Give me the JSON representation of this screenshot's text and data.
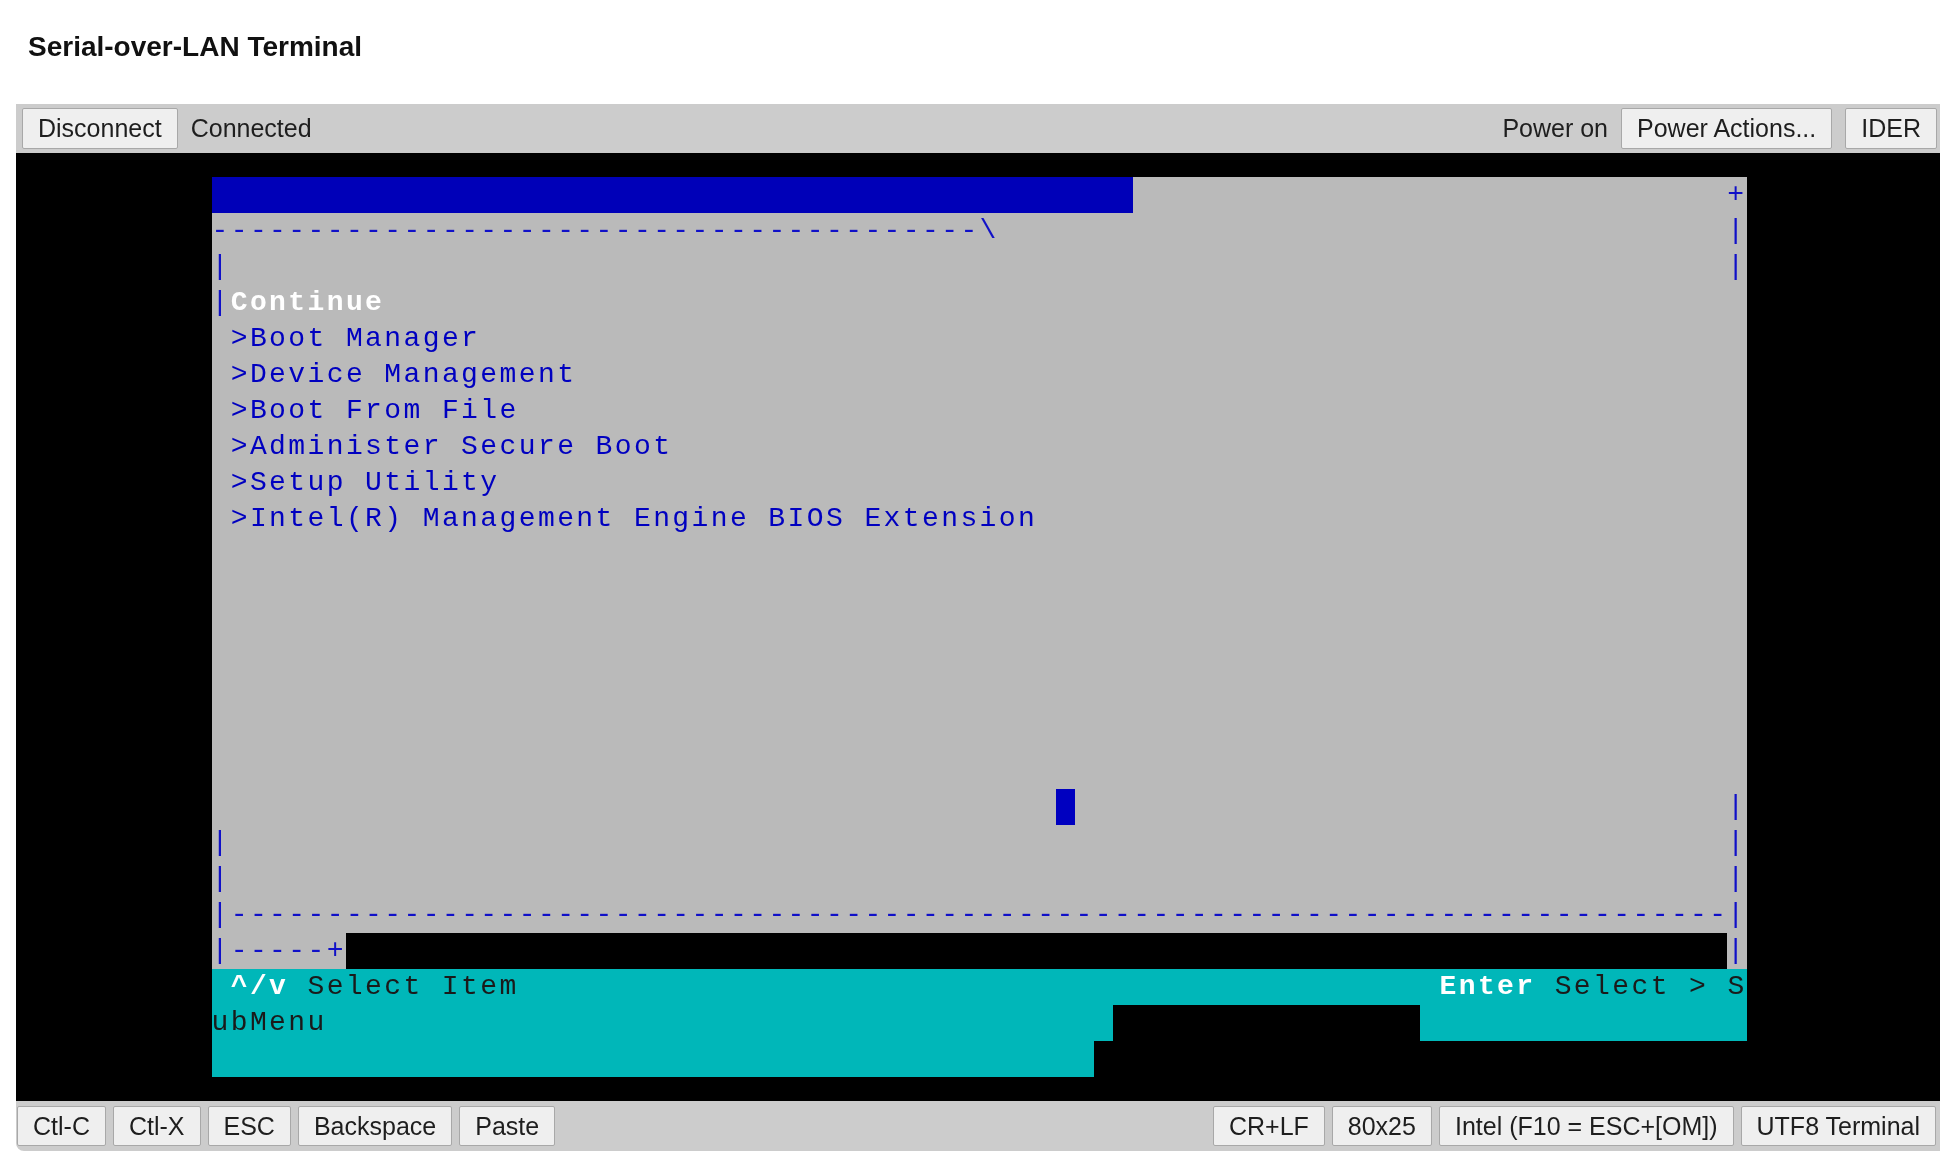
{
  "page_title": "Serial-over-LAN Terminal",
  "toolbar": {
    "left": [
      {
        "kind": "button",
        "label": "Disconnect"
      },
      {
        "kind": "status",
        "label": "Connected"
      }
    ],
    "right": [
      {
        "kind": "status",
        "label": "Power on"
      },
      {
        "kind": "button",
        "label": "Power Actions..."
      },
      {
        "kind": "button",
        "label": "IDER"
      }
    ]
  },
  "terminal": {
    "corner": "+",
    "top_rule": "----------------------------------------\\",
    "left_edges": [
      "|",
      "|",
      "|",
      "|"
    ],
    "right_edges": [
      "|",
      "|",
      "|",
      "|",
      "|",
      "|",
      "|"
    ],
    "menu": [
      {
        "label": "Continue",
        "selected": true
      },
      {
        "label": ">Boot Manager",
        "selected": false
      },
      {
        "label": ">Device Management",
        "selected": false
      },
      {
        "label": ">Boot From File",
        "selected": false
      },
      {
        "label": ">Administer Secure Boot",
        "selected": false
      },
      {
        "label": ">Setup Utility",
        "selected": false
      },
      {
        "label": ">Intel(R) Management Engine BIOS Extension",
        "selected": false
      }
    ],
    "bottom_rule": "|------------------------------------------------------------------------------",
    "status_rule": "|-----+",
    "hints": [
      {
        "kind": "key",
        "text": "^/v"
      },
      {
        "kind": "action",
        "text": "Select Item"
      },
      {
        "kind": "key",
        "text": "Enter"
      },
      {
        "kind": "action",
        "text": "Select > S"
      },
      {
        "kind": "action",
        "text": "ubMenu"
      }
    ]
  },
  "key_bar": {
    "left": [
      "Ctl-C",
      "Ctl-X",
      "ESC",
      "Backspace",
      "Paste"
    ],
    "right": [
      "CR+LF",
      "80x25",
      "Intel (F10 = ESC+[OM])",
      "UTF8 Terminal"
    ]
  }
}
